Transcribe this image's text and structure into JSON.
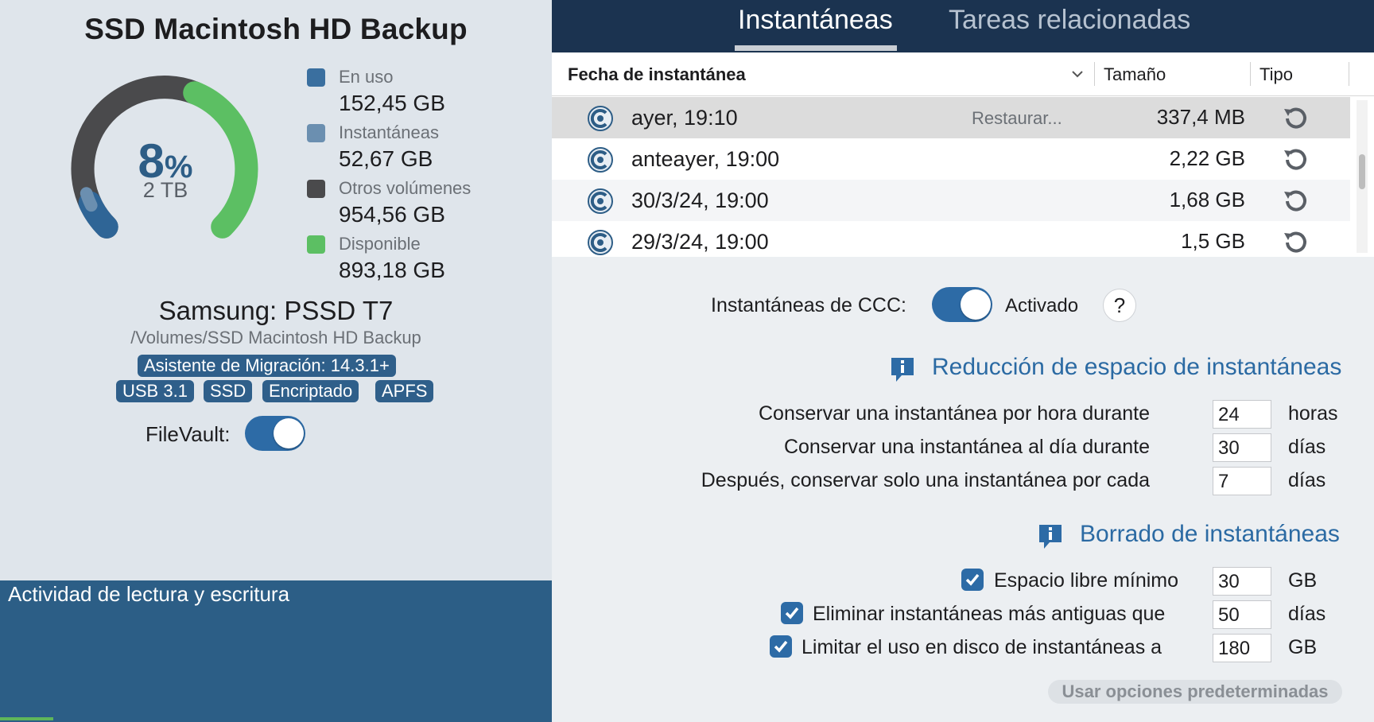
{
  "volume": {
    "title": "SSD Macintosh HD Backup",
    "percent_used": "8",
    "percent_sign": "%",
    "capacity": "2 TB",
    "device": "Samsung: PSSD T7",
    "mount_path": "/Volumes/SSD Macintosh HD Backup",
    "tags": {
      "migration": "Asistente de Migración: 14.3.1+",
      "usb": "USB 3.1",
      "ssd": "SSD",
      "encrypted": "Encriptado",
      "apfs": "APFS"
    },
    "filevault_label": "FileVault:",
    "filevault_on": true,
    "usage_fractions": {
      "used": 0.0762,
      "snapshots": 0.0263,
      "other": 0.4773,
      "available": 0.4466
    }
  },
  "legend": [
    {
      "label": "En uso",
      "value": "152,45 GB",
      "color": "#3a6f9f"
    },
    {
      "label": "Instantáneas",
      "value": "52,67 GB",
      "color": "#6b8fb0"
    },
    {
      "label": "Otros volúmenes",
      "value": "954,56 GB",
      "color": "#4a4a4c"
    },
    {
      "label": "Disponible",
      "value": "893,18 GB",
      "color": "#5cbf63"
    }
  ],
  "activity": {
    "label": "Actividad de lectura y escritura",
    "progress_fraction": 0.097
  },
  "tabs": {
    "snapshots": "Instantáneas",
    "tasks": "Tareas relacionadas"
  },
  "table": {
    "headers": {
      "date": "Fecha de instantánea",
      "size": "Tamaño",
      "type": "Tipo"
    },
    "rows": [
      {
        "date": "ayer, 19:10",
        "restore": "Restaurar...",
        "size": "337,4 MB"
      },
      {
        "date": "anteayer, 19:00",
        "restore": "",
        "size": "2,22 GB"
      },
      {
        "date": "30/3/24, 19:00",
        "restore": "",
        "size": "1,68 GB"
      },
      {
        "date": "29/3/24, 19:00",
        "restore": "",
        "size": "1,5 GB"
      }
    ]
  },
  "settings": {
    "ccc_label": "Instantáneas de CCC:",
    "ccc_state": "Activado",
    "help": "?",
    "reduction_title": "Reducción de espacio de instantáneas",
    "hourly_label": "Conservar una instantánea por hora durante",
    "hourly_value": "24",
    "hourly_unit": "horas",
    "daily_label": "Conservar una instantánea al día durante",
    "daily_value": "30",
    "daily_unit": "días",
    "after_label": "Después, conservar solo una instantánea por cada",
    "after_value": "7",
    "after_unit": "días",
    "deletion_title": "Borrado de instantáneas",
    "min_free_label": "Espacio libre mínimo",
    "min_free_value": "30",
    "min_free_unit": "GB",
    "older_label": "Eliminar instantáneas más antiguas que",
    "older_value": "50",
    "older_unit": "días",
    "limit_label": "Limitar el uso en disco de instantáneas a",
    "limit_value": "180",
    "limit_unit": "GB",
    "defaults_button": "Usar opciones predeterminadas"
  }
}
